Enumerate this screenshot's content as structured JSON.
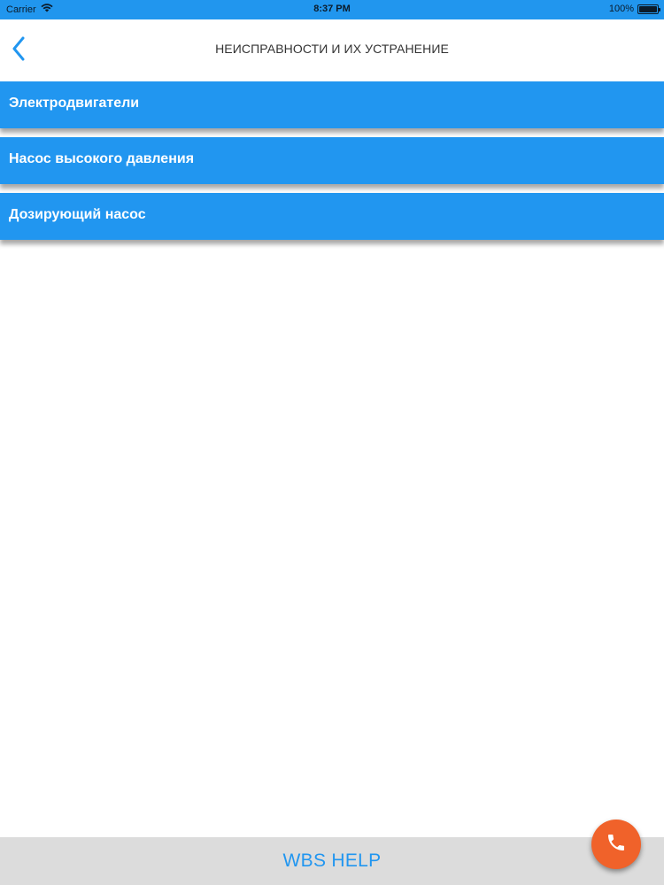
{
  "status_bar": {
    "carrier": "Carrier",
    "time": "8:37 PM",
    "battery": "100%",
    "battery_level": 1.0
  },
  "nav": {
    "back_icon": "chevron-left-icon",
    "title": "НЕИСПРАВНОСТИ И ИХ УСТРАНЕНИЕ"
  },
  "menu": {
    "items": [
      {
        "label": "Электродвигатели"
      },
      {
        "label": "Насос высокого давления"
      },
      {
        "label": "Дозирующий насос"
      }
    ]
  },
  "footer": {
    "title": "WBS HELP"
  },
  "fab": {
    "icon": "phone-icon"
  },
  "colors": {
    "accent": "#2196F0",
    "status_bar": "#2196EE",
    "fab": "#F0622A",
    "footer_bg": "#DCDCDC"
  }
}
